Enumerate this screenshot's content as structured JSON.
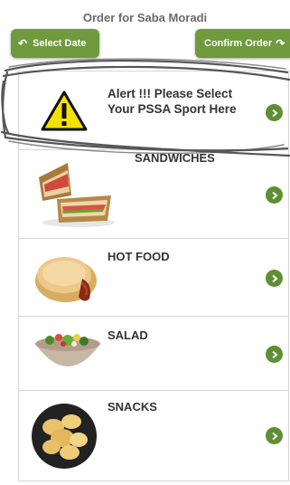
{
  "header": {
    "title": "Order for Saba Moradi",
    "select_date_label": "Select Date",
    "confirm_order_label": "Confirm Order"
  },
  "rows": [
    {
      "title": "Alert !!! Please Select Your PSSA Sport Here",
      "icon": "warning-icon"
    },
    {
      "title": "SANDWICHES",
      "icon": "sandwich-image"
    },
    {
      "title": "HOT FOOD",
      "icon": "pie-image"
    },
    {
      "title": "SALAD",
      "icon": "salad-bowl-image"
    },
    {
      "title": "SNACKS",
      "icon": "chips-image"
    }
  ],
  "colors": {
    "button_green": "#6f9a3d",
    "chevron_green": "#5f8f34",
    "warning_yellow": "#f5e100"
  }
}
